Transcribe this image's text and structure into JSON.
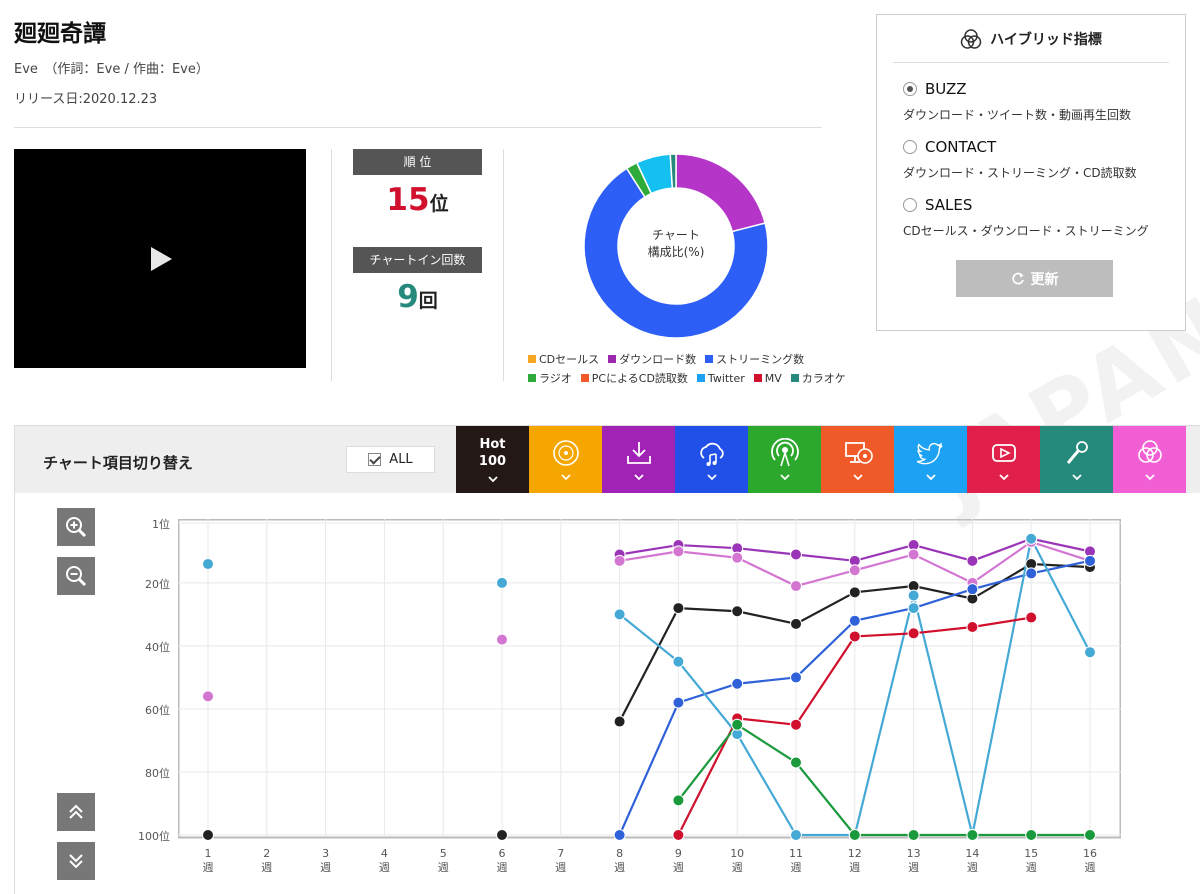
{
  "song": {
    "title": "廻廻奇譚",
    "credit": "Eve　（作詞：Eve / 作曲：Eve）",
    "release": "リリース日:2020.12.23"
  },
  "stats": {
    "rank_label": "順 位",
    "rank_value": "15",
    "rank_unit": "位",
    "chartin_label": "チャートイン回数",
    "chartin_value": "9",
    "chartin_unit": "回"
  },
  "colors": {
    "rank_red": "#d0102c",
    "chartin_green": "#258a7c"
  },
  "composition": {
    "center_line1": "チャート",
    "center_line2": "構成比(%)",
    "legend": [
      {
        "label": "CDセールス",
        "color": "#f5a623"
      },
      {
        "label": "ダウンロード数",
        "color": "#9b27af"
      },
      {
        "label": "ストリーミング数",
        "color": "#2d5ff6"
      },
      {
        "label": "ラジオ",
        "color": "#2eaa3a"
      },
      {
        "label": "PCによるCD読取数",
        "color": "#f05a28"
      },
      {
        "label": "Twitter",
        "color": "#1da1f2"
      },
      {
        "label": "MV",
        "color": "#d0102c"
      },
      {
        "label": "カラオケ",
        "color": "#258a7c"
      }
    ],
    "slices": [
      {
        "name": "ダウンロード数",
        "value": 21,
        "color": "#b535c8"
      },
      {
        "name": "ストリーミング数",
        "value": 70,
        "color": "#2d5ff6"
      },
      {
        "name": "ラジオ",
        "value": 2,
        "color": "#2eaa3a"
      },
      {
        "name": "Twitter",
        "value": 6,
        "color": "#14c0f0"
      },
      {
        "name": "カラオケ",
        "value": 1,
        "color": "#258a7c"
      }
    ]
  },
  "hybrid": {
    "title": "ハイブリッド指標",
    "options": [
      {
        "label": "BUZZ",
        "desc": "ダウンロード・ツイート数・動画再生回数",
        "selected": true
      },
      {
        "label": "CONTACT",
        "desc": "ダウンロード・ストリーミング・CD読取数",
        "selected": false
      },
      {
        "label": "SALES",
        "desc": "CDセールス・ダウンロード・ストリーミング",
        "selected": false
      }
    ],
    "refresh_label": "更新"
  },
  "switcher": {
    "title": "チャート項目切り替え",
    "all_label": "ALL",
    "hot_line1": "Hot",
    "hot_line2": "100",
    "buttons": [
      {
        "icon": "hot100-icon",
        "color": "#231815"
      },
      {
        "icon": "cd-icon",
        "color": "#f5a600"
      },
      {
        "icon": "download-icon",
        "color": "#a023b5"
      },
      {
        "icon": "streaming-icon",
        "color": "#2050e8"
      },
      {
        "icon": "radio-icon",
        "color": "#2ca82c"
      },
      {
        "icon": "pc-cd-icon",
        "color": "#f05a28"
      },
      {
        "icon": "twitter-icon",
        "color": "#1da1f2"
      },
      {
        "icon": "youtube-icon",
        "color": "#e0204a"
      },
      {
        "icon": "karaoke-icon",
        "color": "#258a7c"
      },
      {
        "icon": "hybrid-icon",
        "color": "#f25fd4"
      }
    ]
  },
  "watermark": "JAPAN",
  "chart_data": {
    "type": "line",
    "x": [
      1,
      2,
      3,
      4,
      5,
      6,
      7,
      8,
      9,
      10,
      11,
      12,
      13,
      14,
      15,
      16
    ],
    "x_tick_labels": [
      "1\n週",
      "2\n週",
      "3\n週",
      "4\n週",
      "5\n週",
      "6\n週",
      "7\n週",
      "8\n週",
      "9\n週",
      "10\n週",
      "11\n週",
      "12\n週",
      "13\n週",
      "14\n週",
      "15\n週",
      "16\n週"
    ],
    "y_tick_labels": [
      "1位",
      "20位",
      "40位",
      "60位",
      "80位",
      "100位"
    ],
    "y_ticks": [
      1,
      20,
      40,
      60,
      80,
      100
    ],
    "ylim": [
      1,
      100
    ],
    "y_inverted": true,
    "grid": true,
    "series": [
      {
        "color": "#222222",
        "values": [
          100,
          null,
          null,
          null,
          null,
          100,
          null,
          64,
          28,
          29,
          33,
          23,
          21,
          25,
          14,
          15
        ]
      },
      {
        "color": "#9b35b8",
        "values": [
          null,
          null,
          null,
          null,
          null,
          null,
          null,
          11,
          8,
          9,
          11,
          13,
          8,
          13,
          6,
          10
        ]
      },
      {
        "color": "#d276d2",
        "values": [
          56,
          null,
          null,
          null,
          null,
          38,
          null,
          13,
          10,
          12,
          21,
          16,
          11,
          20,
          7,
          13
        ]
      },
      {
        "color": "#2f62d8",
        "values": [
          null,
          null,
          null,
          null,
          null,
          null,
          null,
          100,
          58,
          52,
          50,
          32,
          28,
          22,
          17,
          13
        ]
      },
      {
        "color": "#45a9d6",
        "values": [
          14,
          null,
          null,
          null,
          null,
          20,
          null,
          30,
          45,
          68,
          100,
          100,
          24,
          100,
          6,
          42
        ]
      },
      {
        "color": "#45a9d6",
        "values": [
          null,
          null,
          null,
          null,
          null,
          null,
          null,
          null,
          null,
          null,
          null,
          null,
          28,
          null,
          null,
          null
        ]
      },
      {
        "color": "#d0102c",
        "values": [
          null,
          null,
          null,
          null,
          null,
          null,
          null,
          null,
          100,
          63,
          65,
          37,
          36,
          34,
          31,
          null
        ]
      },
      {
        "color": "#1a9a3c",
        "values": [
          null,
          null,
          null,
          null,
          null,
          null,
          null,
          null,
          89,
          65,
          77,
          100,
          100,
          100,
          100,
          100
        ]
      }
    ]
  }
}
